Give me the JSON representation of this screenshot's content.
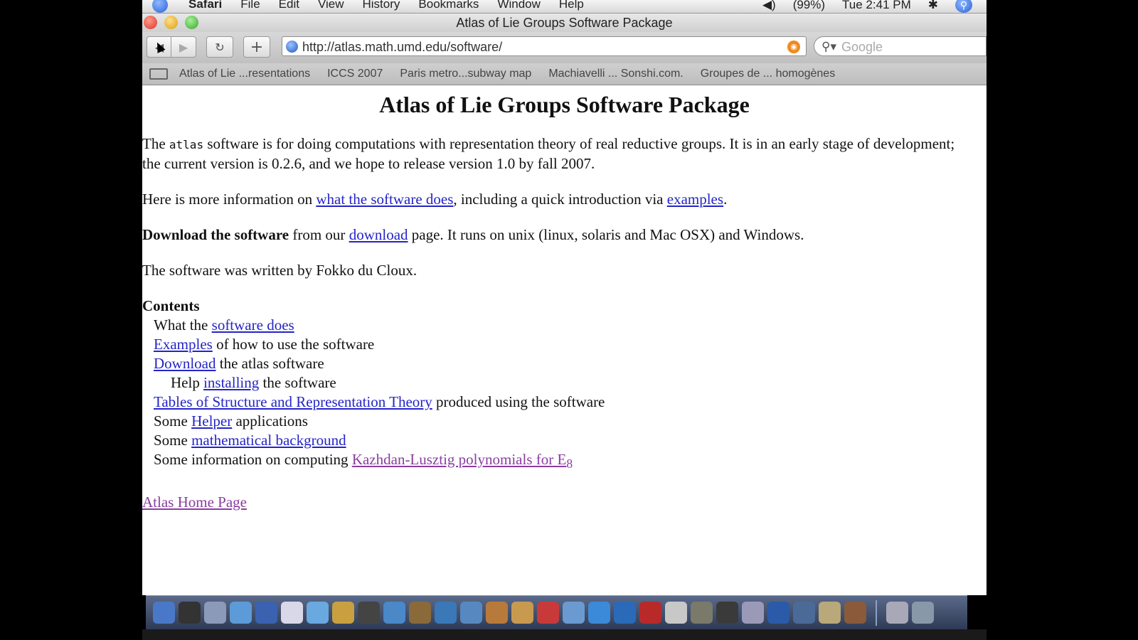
{
  "menubar": {
    "app_name": "Safari",
    "menus": [
      "File",
      "Edit",
      "View",
      "History",
      "Bookmarks",
      "Window",
      "Help"
    ],
    "battery": "(99%)",
    "clock": "Tue 2:41 PM",
    "bluetooth": "✱"
  },
  "window": {
    "title": "Atlas of Lie Groups Software Package"
  },
  "toolbar": {
    "url": "http://atlas.math.umd.edu/software/",
    "search_placeholder": "Google",
    "reload_glyph": "↻",
    "add_glyph": "+",
    "back_glyph": "◀",
    "forward_glyph": "▶"
  },
  "bookmarks": [
    "Atlas of Lie ...resentations",
    "ICCS 2007",
    "Paris metro...subway map",
    "Machiavelli ... Sonshi.com.",
    "Groupes de ... homogènes"
  ],
  "page": {
    "heading": "Atlas of Lie Groups Software Package",
    "p1_start": "The ",
    "p1_code": "atlas",
    "p1_end": " software is for doing computations with representation theory of real reductive groups. It is in an early stage of development; the current version is 0.2.6, and we hope to release version 1.0 by fall 2007.",
    "p2_start": "Here is more information on ",
    "p2_link1": "what the software does",
    "p2_mid": ", including a quick introduction via ",
    "p2_link2": "examples",
    "p2_end": ".",
    "p3_bold": "Download the software",
    "p3_mid": " from our ",
    "p3_link": "download",
    "p3_end": " page. It runs on unix (linux, solaris and Mac OSX) and Windows.",
    "p4": "The software was written by Fokko du Cloux.",
    "contents_title": "Contents",
    "contents": {
      "i1_pre": "What the ",
      "i1_link": "software does",
      "i2_link": "Examples",
      "i2_post": " of how to use the software",
      "i3_link": "Download",
      "i3_post": " the atlas software",
      "i4_pre": "Help ",
      "i4_link": "installing",
      "i4_post": " the software",
      "i5_link": "Tables of Structure and Representation Theory",
      "i5_post": " produced using the software",
      "i6_pre": "Some ",
      "i6_link": "Helper",
      "i6_post": " applications",
      "i7_pre": "Some ",
      "i7_link": "mathematical background",
      "i8_pre": "Some information on computing ",
      "i8_link": "Kazhdan-Lusztig polynomials for E",
      "i8_sub": "8"
    },
    "home_link": "Atlas Home Page"
  },
  "colors": {
    "link": "#2424c8",
    "visited_link": "#8a3da0"
  }
}
